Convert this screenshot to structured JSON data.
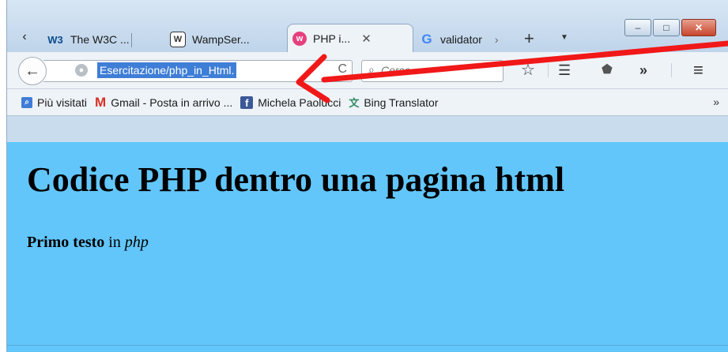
{
  "tabs": [
    {
      "label": "The W3C ...",
      "icon": "w3c-icon",
      "icon_text": "W3"
    },
    {
      "label": "WampSer...",
      "icon": "wampserver-icon"
    },
    {
      "label": "PHP i...",
      "icon": "php-tab-icon",
      "active": true
    },
    {
      "label": "validator",
      "icon": "google-icon",
      "icon_text": "G"
    }
  ],
  "nav": {
    "url": "Esercitazione/php_in_Html.",
    "search_placeholder": "Cerca"
  },
  "bookmarks": [
    {
      "label": "Più visitati",
      "icon": "most-visited-icon"
    },
    {
      "label": "Gmail - Posta in arrivo ...",
      "icon": "gmail-icon",
      "icon_text": "M"
    },
    {
      "label": "Michela Paolucci",
      "icon": "facebook-icon",
      "icon_text": "f"
    },
    {
      "label": "Bing Translator",
      "icon": "bing-translator-icon"
    }
  ],
  "page": {
    "heading": "Codice PHP dentro una pagina html",
    "para_bold": "Primo testo",
    "para_mid": " in ",
    "para_italic": "php"
  },
  "colors": {
    "page_background": "#62c6fb",
    "url_selection": "#3f7ed6",
    "annotation_arrow": "#f01818"
  }
}
